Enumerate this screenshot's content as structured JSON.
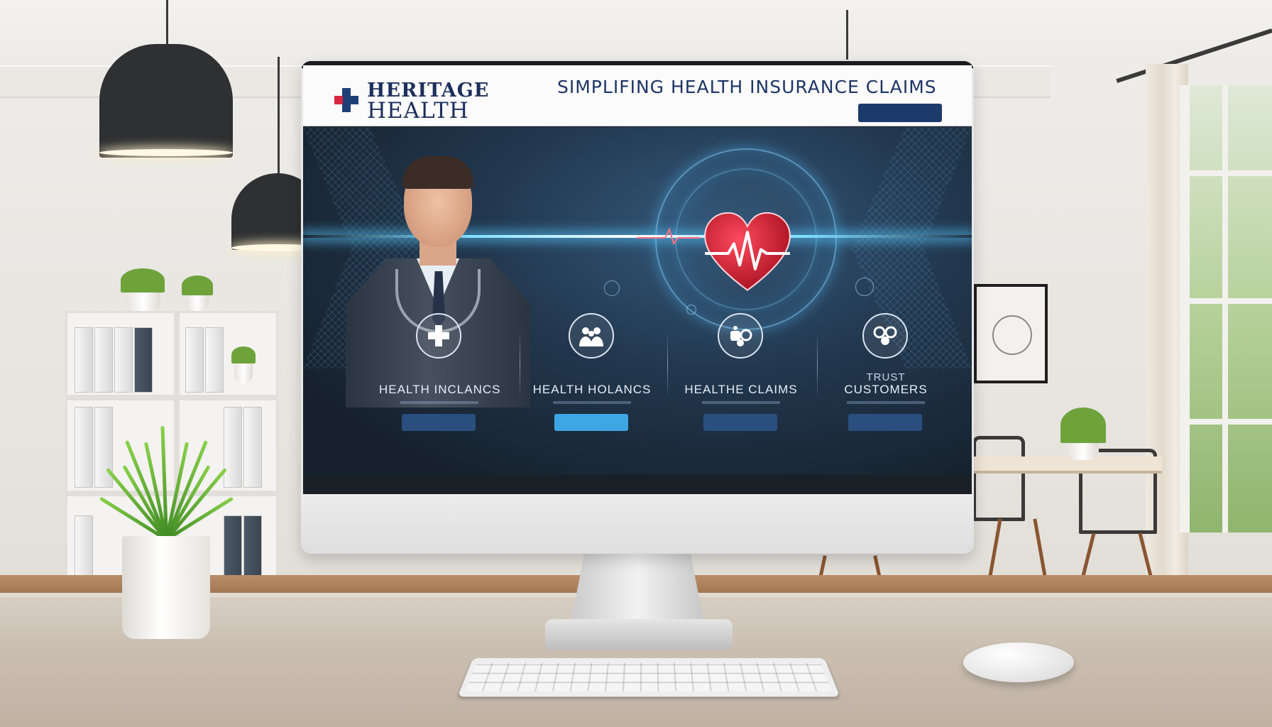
{
  "site": {
    "logo_line1": "HERITAGE",
    "logo_line2": "HEALTH",
    "tagline": "SIMPLIFING HEALTH INSURANCE CLAIMS",
    "nav": [
      "",
      "",
      "",
      ""
    ],
    "cta_label": ""
  },
  "features": [
    {
      "icon": "medical-cross-icon",
      "kicker": "",
      "title": "HEALTH INCLANCS",
      "button": ""
    },
    {
      "icon": "family-group-icon",
      "kicker": "",
      "title": "HEALTH HOLANCS",
      "button": ""
    },
    {
      "icon": "claims-icon",
      "kicker": "",
      "title": "HEALTHE CLAIMS",
      "button": ""
    },
    {
      "icon": "trust-people-icon",
      "kicker": "TRUST",
      "title": "CUSTOMERS",
      "button": ""
    }
  ],
  "colors": {
    "brand_navy": "#1e2f5c",
    "brand_red": "#d7263d",
    "hero_bg": "#22384f",
    "accent_blue": "#3fa6e6"
  }
}
